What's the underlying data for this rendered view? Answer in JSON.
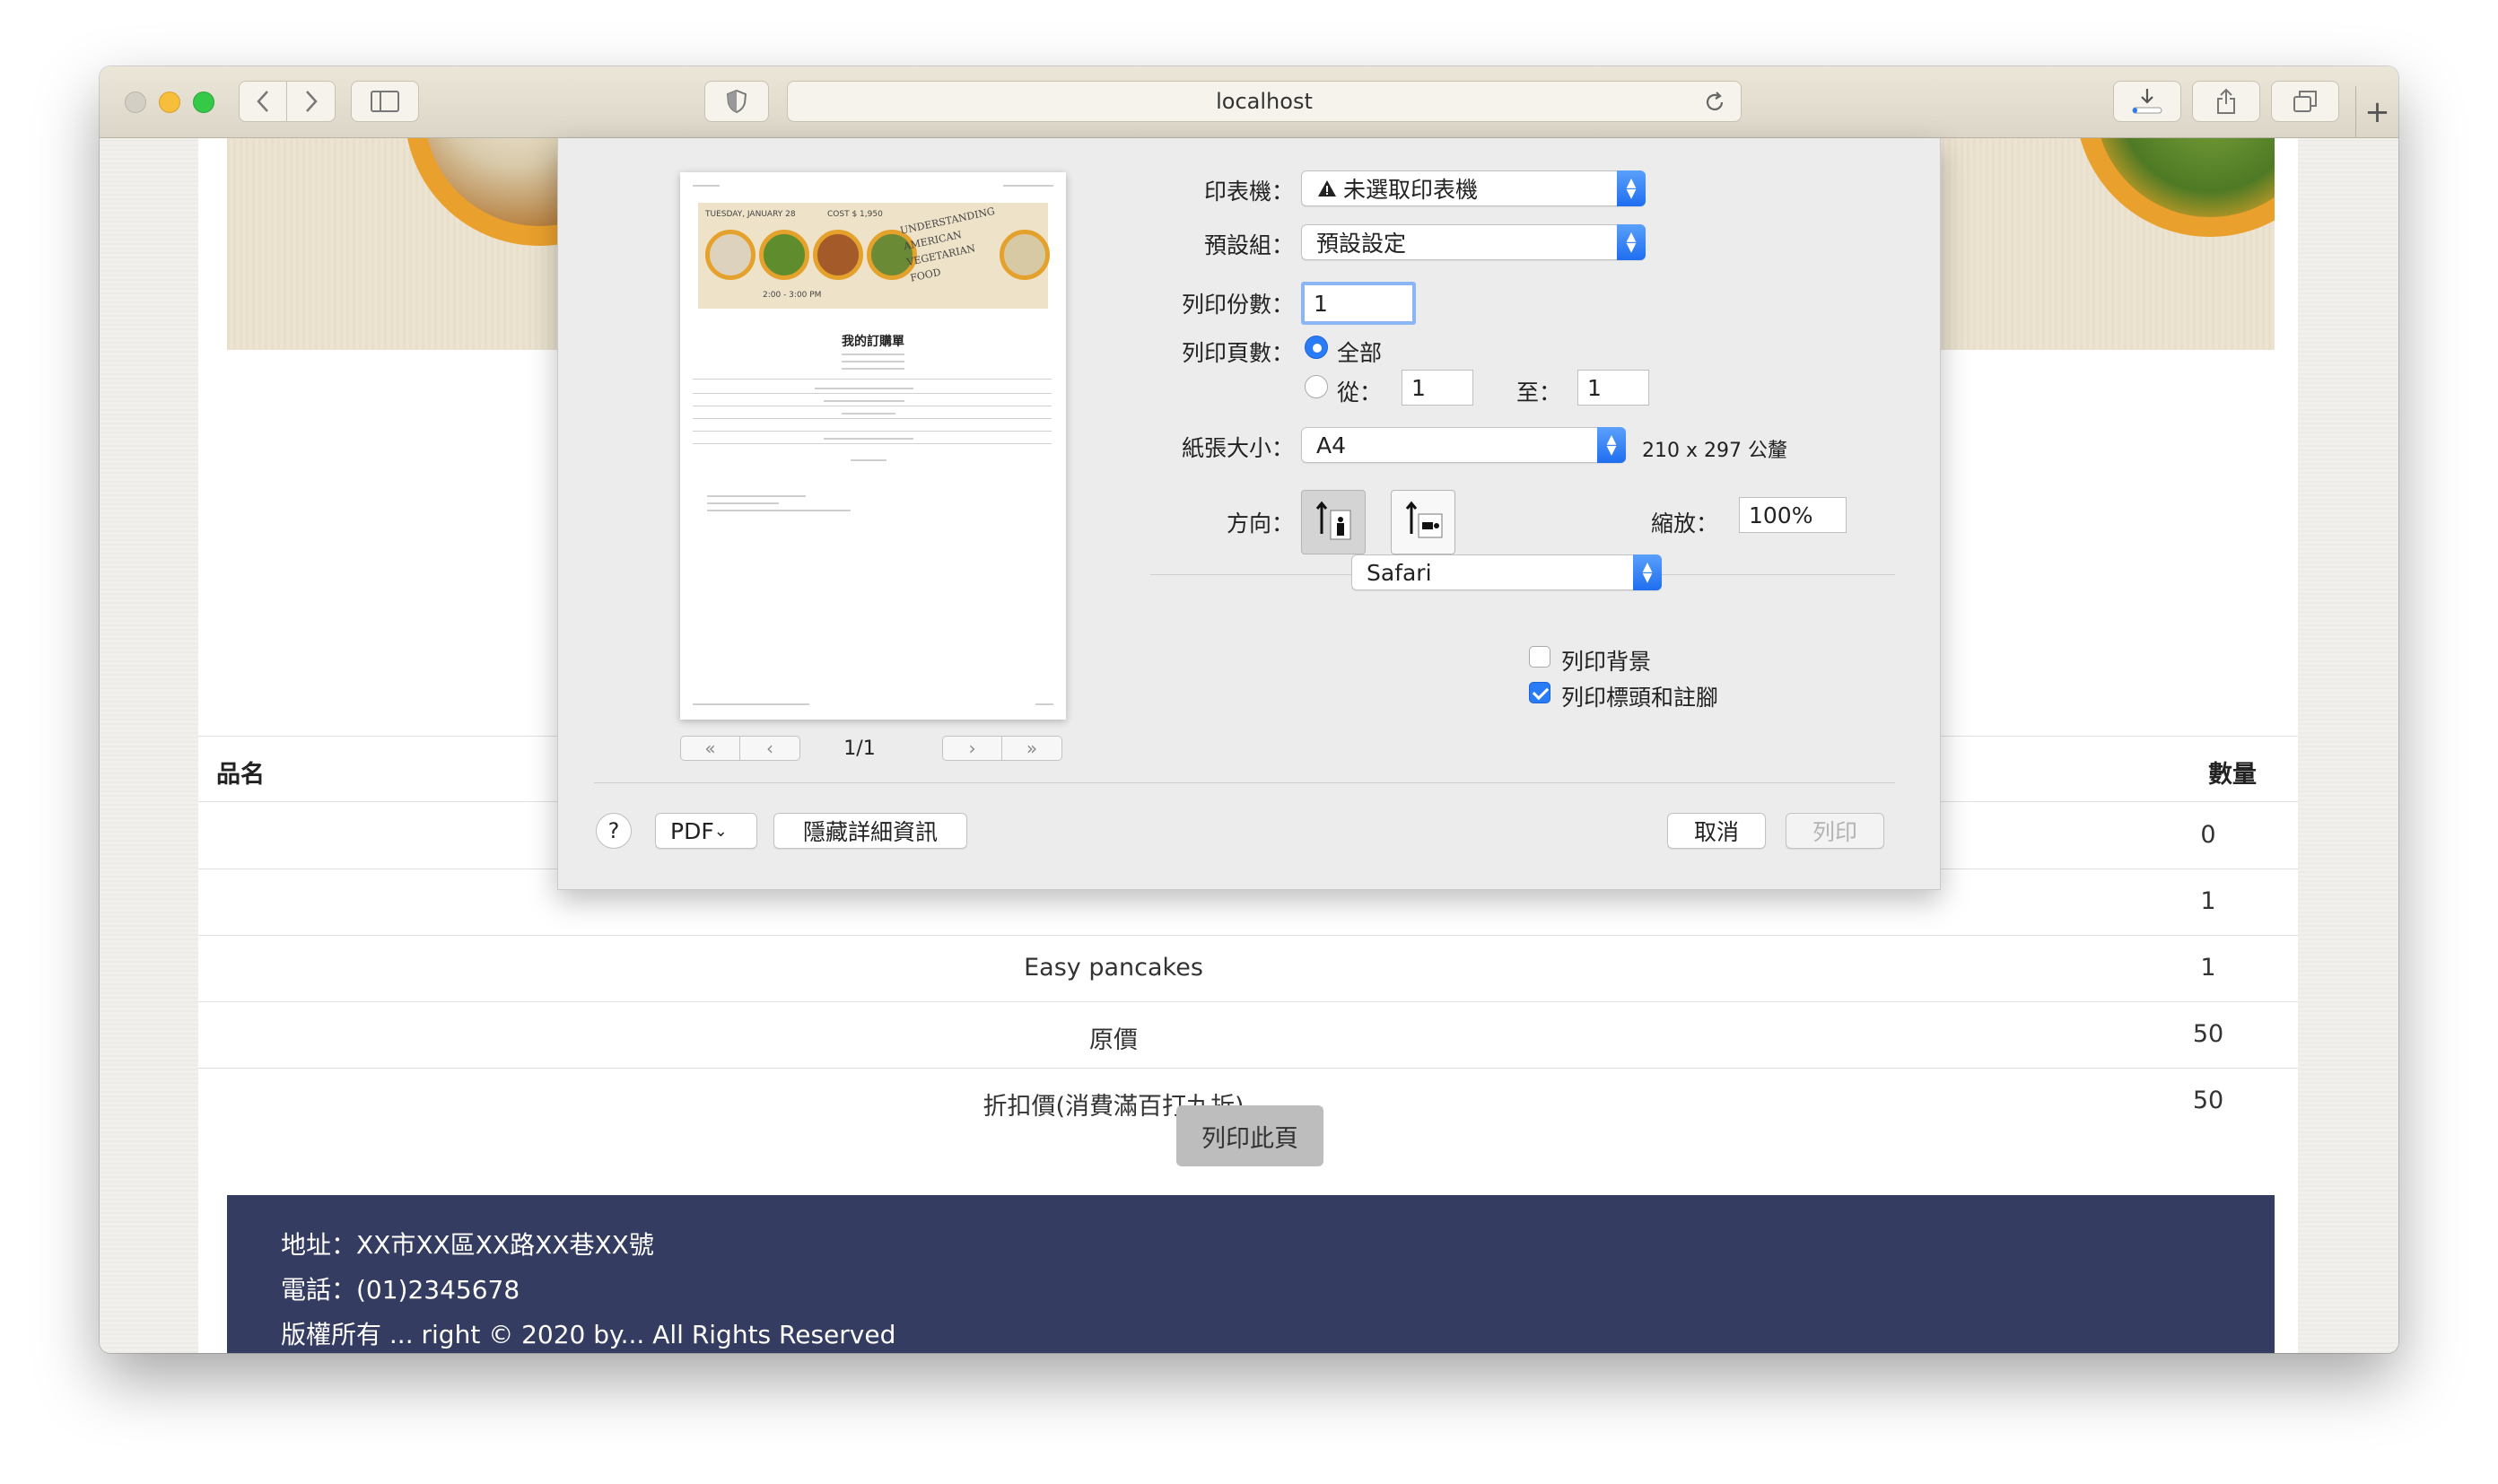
{
  "browser": {
    "url": "localhost",
    "icons": {
      "back": "chevron-left-icon",
      "forward": "chevron-right-icon",
      "sidebar": "sidebar-icon",
      "privacy": "shield-icon",
      "reload": "reload-icon",
      "downloads": "download-icon",
      "share": "share-icon",
      "tabs": "tabs-icon",
      "new_tab": "+"
    }
  },
  "table": {
    "headers": {
      "name": "品名",
      "qty": "數量"
    },
    "rows": [
      {
        "name": "",
        "qty": "0"
      },
      {
        "name": "",
        "qty": "1"
      },
      {
        "name": "Easy pancakes",
        "qty": "1"
      },
      {
        "name": "原價",
        "qty": "50"
      },
      {
        "name": "折扣價(消費滿百打九折)",
        "qty": "50"
      }
    ]
  },
  "print_page_button": "列印此頁",
  "footer": {
    "address": "地址：XX市XX區XX路XX巷XX號",
    "phone": "電話：(01)2345678",
    "copyright_partial": "版權所有 ... right © 2020 by... All Rights Reserved"
  },
  "print_dialog": {
    "preview": {
      "page_indicator": "1/1",
      "doc_title": "我的訂購單",
      "banner_date": "TUESDAY, JANUARY 28",
      "banner_price": "COST $ 1,950",
      "banner_time": "2:00 - 3:00 PM",
      "banner_heading": "UNDERSTANDING AMERICAN VEGETARIAN FOOD"
    },
    "printer": {
      "label": "印表機：",
      "value": "未選取印表機",
      "warning_icon": "warning-icon"
    },
    "presets": {
      "label": "預設組：",
      "value": "預設設定"
    },
    "copies": {
      "label": "列印份數：",
      "value": "1"
    },
    "pages": {
      "label": "列印頁數：",
      "all_label": "全部",
      "from_label": "從：",
      "from_value": "1",
      "to_label": "至：",
      "to_value": "1"
    },
    "paper_size": {
      "label": "紙張大小：",
      "value": "A4",
      "dimensions": "210 x 297 公釐"
    },
    "orientation": {
      "label": "方向：",
      "portrait_icon": "portrait-orientation-icon",
      "landscape_icon": "landscape-orientation-icon"
    },
    "scale": {
      "label": "縮放：",
      "value": "100%"
    },
    "section_popup": "Safari",
    "options": {
      "print_backgrounds": "列印背景",
      "print_headers_footers": "列印標頭和註腳"
    },
    "buttons": {
      "help": "?",
      "pdf": "PDF",
      "hide_details": "隱藏詳細資訊",
      "cancel": "取消",
      "print": "列印"
    }
  }
}
